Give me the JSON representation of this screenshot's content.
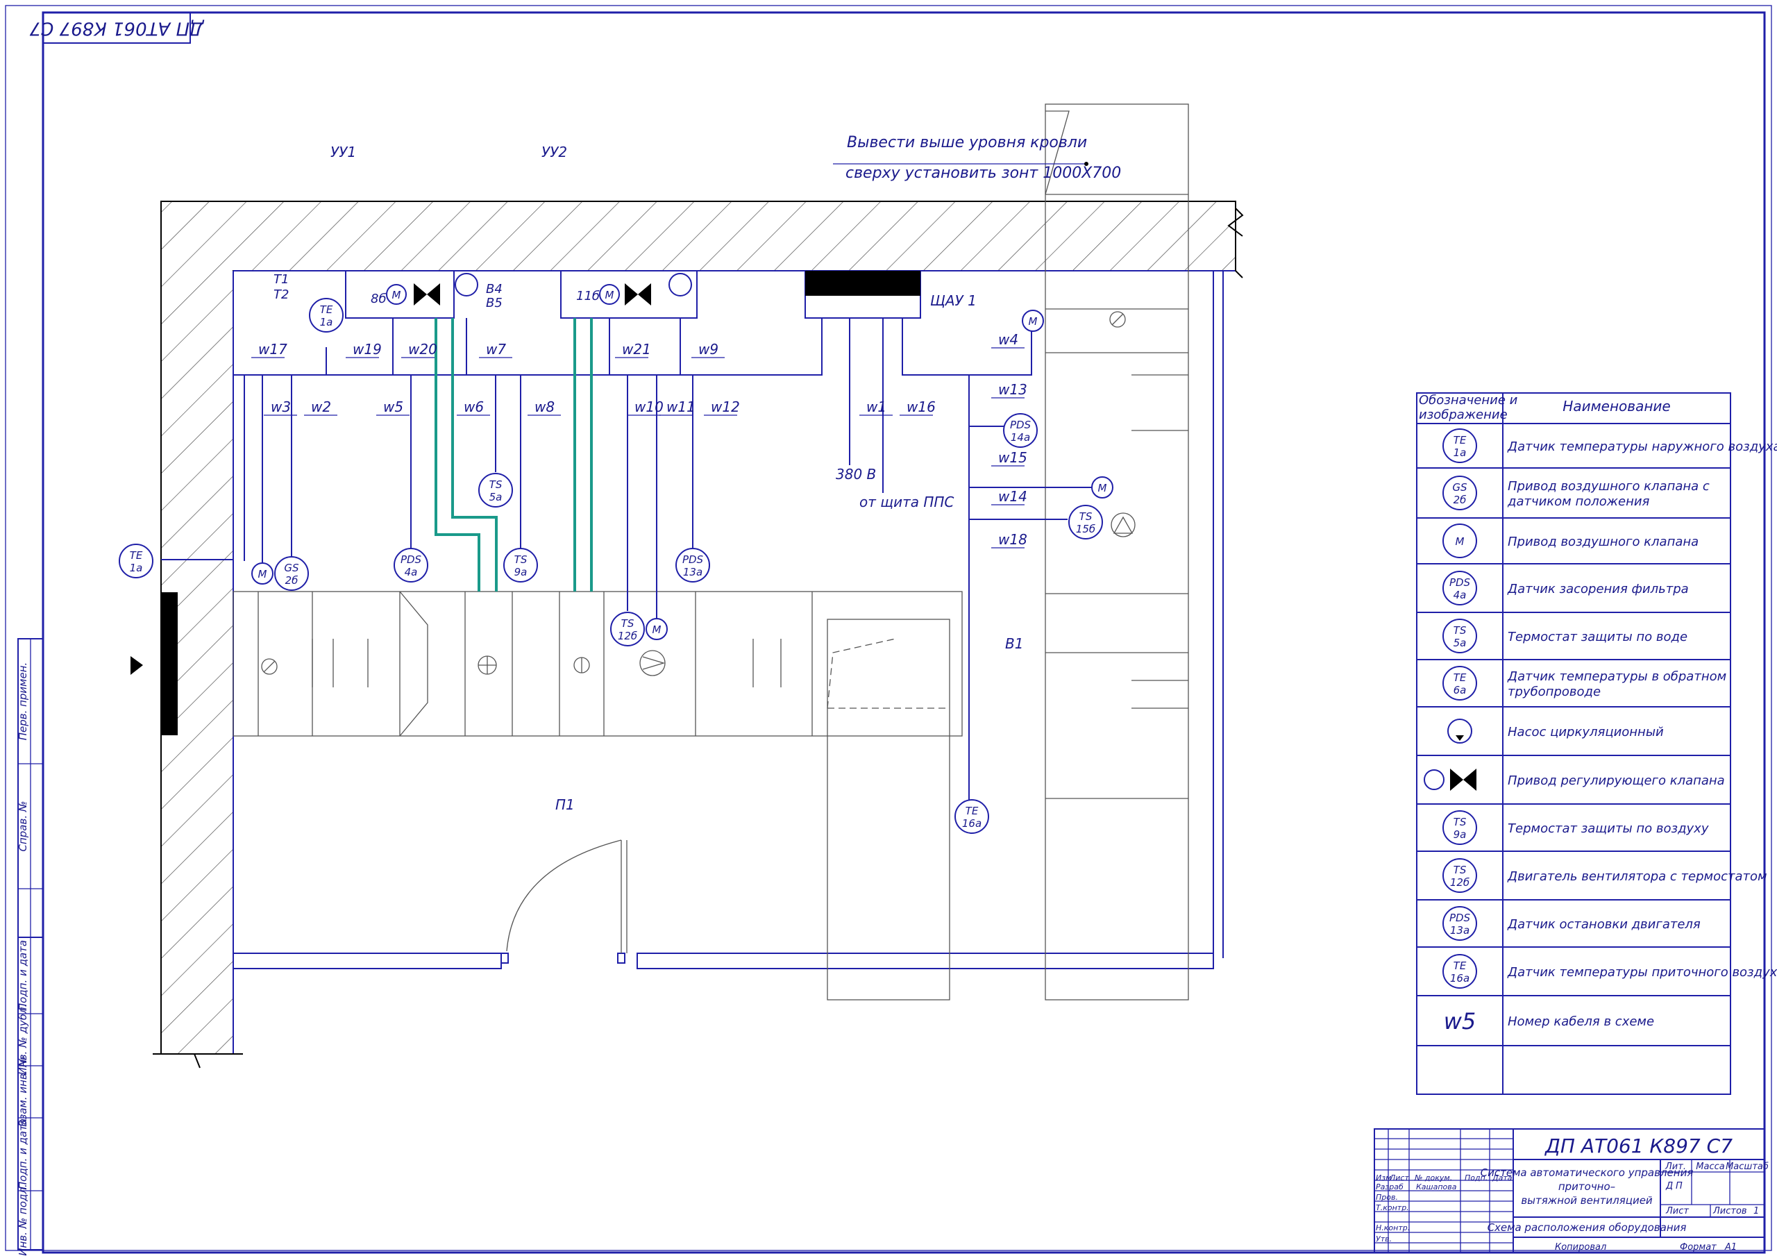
{
  "drawing_code": "ДП АТ061 К897 С7",
  "top_note": {
    "line1": "Вывести выше уровня кровли",
    "line2": "сверху установить зонт 1000Х700"
  },
  "labels": {
    "uu1": "УУ1",
    "uu2": "УУ2",
    "shau": "ЩАУ 1",
    "p1": "П1",
    "b1": "В1",
    "v380": "380 В",
    "pps": "от щита ППС",
    "t1": "Т1",
    "t2": "Т2",
    "b4": "В4",
    "b5": "В5",
    "n8b": "8б",
    "n11b": "11б"
  },
  "cables": [
    "w17",
    "w3",
    "w2",
    "w19",
    "w20",
    "w5",
    "w6",
    "w7",
    "w8",
    "w21",
    "w10",
    "w11",
    "w9",
    "w12",
    "w1",
    "w16",
    "w4",
    "w13",
    "w15",
    "w14",
    "w18"
  ],
  "sensors": {
    "te1a": [
      "ТЕ",
      "1а"
    ],
    "gs2b": [
      "GS",
      "2б"
    ],
    "pds4a": [
      "PDS",
      "4а"
    ],
    "ts5a": [
      "TS",
      "5а"
    ],
    "ts9a": [
      "TS",
      "9а"
    ],
    "pds13a": [
      "PDS",
      "13а"
    ],
    "ts12b": [
      "TS",
      "12б"
    ],
    "pds14a": [
      "PDS",
      "14а"
    ],
    "ts15b": [
      "TS",
      "15б"
    ],
    "te16a": [
      "ТЕ",
      "16а"
    ],
    "m": "М"
  },
  "legend": {
    "header_col1": [
      "Обозначение и",
      "изображение"
    ],
    "header_col2": "Наименование",
    "rows": [
      {
        "sym": [
          "ТЕ",
          "1а"
        ],
        "name": [
          "Датчик температуры наружного воздуха"
        ]
      },
      {
        "sym": [
          "GS",
          "2б"
        ],
        "name": [
          "Привод воздушного клапана с",
          "датчиком положения"
        ]
      },
      {
        "sym": [
          "М"
        ],
        "name": [
          "Привод воздушного клапана"
        ]
      },
      {
        "sym": [
          "PDS",
          "4а"
        ],
        "name": [
          "Датчик засорения фильтра"
        ]
      },
      {
        "sym": [
          "TS",
          "5а"
        ],
        "name": [
          "Термостат защиты по воде"
        ]
      },
      {
        "sym": [
          "ТЕ",
          "6а"
        ],
        "name": [
          "Датчик температуры в обратном",
          "трубопроводе"
        ]
      },
      {
        "sym": [],
        "name": [
          "Насос циркуляционный"
        ]
      },
      {
        "sym": [],
        "name": [
          "Привод регулирующего клапана"
        ]
      },
      {
        "sym": [
          "TS",
          "9а"
        ],
        "name": [
          "Термостат защиты по воздуху"
        ]
      },
      {
        "sym": [
          "TS",
          "12б"
        ],
        "name": [
          "Двигатель вентилятора с термостатом"
        ]
      },
      {
        "sym": [
          "PDS",
          "13а"
        ],
        "name": [
          "Датчик остановки двигателя"
        ]
      },
      {
        "sym": [
          "ТЕ",
          "16а"
        ],
        "name": [
          "Датчик температуры приточного воздуха"
        ]
      },
      {
        "sym": [
          "w5"
        ],
        "name": [
          "Номер кабеля в схеме"
        ]
      }
    ]
  },
  "title_block": {
    "code": "ДП АТ061 К897 С7",
    "system_title": [
      "Система автоматического управления",
      "приточно–",
      "вытяжной вентиляцией"
    ],
    "sheet_title": "Схема расположения оборудования",
    "col_headers": [
      "Изм",
      "Лист",
      "№ докум.",
      "Подп.",
      "Дата"
    ],
    "roles": [
      "Разраб",
      "Пров.",
      "Т.контр.",
      "",
      "Н.контр.",
      "Утв."
    ],
    "author": "Кашапова",
    "lit": "Лит.",
    "mass": "Масса",
    "scale": "Масштаб",
    "lit_values": [
      "Д",
      "П"
    ],
    "sheet_label": "Лист",
    "sheets_label": "Листов",
    "sheets_value": "1",
    "copied": "Копировал",
    "format_label": "Формат",
    "format_value": "А1"
  },
  "side_stamp": [
    "Перв. примен.",
    "Справ. №",
    "Подп. и дата",
    "Инв. № дубл.",
    "Взам. инв. №",
    "Подп. и дата",
    "Инв. № подл."
  ],
  "colors": {
    "line": "#1f1fa8",
    "pipe": "#1a9a8a",
    "wall": "#000000"
  }
}
